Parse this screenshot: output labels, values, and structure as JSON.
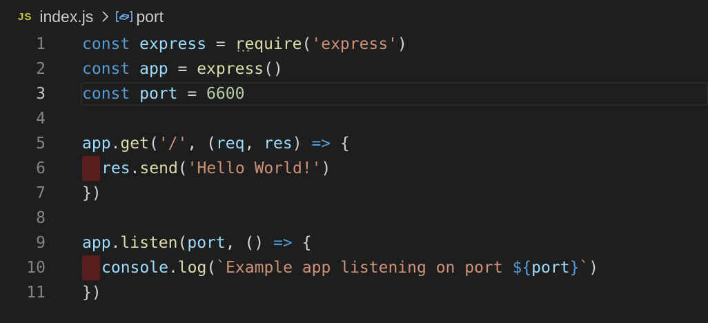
{
  "breadcrumb": {
    "file_icon": "JS",
    "file_name": "index.js",
    "separator_icon": "chevron-right-icon",
    "symbol_icon": "variable-icon",
    "symbol_name": "port"
  },
  "colors": {
    "background": "#1e1e1e",
    "keyword": "#569cd6",
    "variable": "#9cdcfe",
    "function": "#dcdcaa",
    "string": "#ce9178",
    "number": "#b5cea8",
    "indent_error": "#5a1d1d"
  },
  "editor": {
    "current_line": 3,
    "lines": [
      {
        "num": "1",
        "tokens": [
          [
            "kw",
            "const"
          ],
          [
            "op",
            " "
          ],
          [
            "var",
            "express"
          ],
          [
            "op",
            " = "
          ],
          [
            "fn",
            "require",
            "dotted"
          ],
          [
            "par",
            "("
          ],
          [
            "str",
            "'express'"
          ],
          [
            "par",
            ")"
          ]
        ]
      },
      {
        "num": "2",
        "tokens": [
          [
            "kw",
            "const"
          ],
          [
            "op",
            " "
          ],
          [
            "var",
            "app"
          ],
          [
            "op",
            " = "
          ],
          [
            "fn",
            "express"
          ],
          [
            "par",
            "()"
          ]
        ]
      },
      {
        "num": "3",
        "tokens": [
          [
            "kw",
            "const"
          ],
          [
            "op",
            " "
          ],
          [
            "var",
            "port"
          ],
          [
            "op",
            " = "
          ],
          [
            "num",
            "6600"
          ]
        ]
      },
      {
        "num": "4",
        "tokens": []
      },
      {
        "num": "5",
        "tokens": [
          [
            "var",
            "app"
          ],
          [
            "op",
            "."
          ],
          [
            "fn",
            "get"
          ],
          [
            "par",
            "("
          ],
          [
            "str",
            "'/'"
          ],
          [
            "op",
            ", "
          ],
          [
            "par",
            "("
          ],
          [
            "var",
            "req"
          ],
          [
            "op",
            ", "
          ],
          [
            "var",
            "res"
          ],
          [
            "par",
            ")"
          ],
          [
            "op",
            " "
          ],
          [
            "arrow",
            "=>"
          ],
          [
            "op",
            " "
          ],
          [
            "par",
            "{"
          ]
        ]
      },
      {
        "num": "6",
        "indent_error": true,
        "tokens": [
          [
            "var",
            "res"
          ],
          [
            "op",
            "."
          ],
          [
            "fn",
            "send"
          ],
          [
            "par",
            "("
          ],
          [
            "str",
            "'Hello World!'"
          ],
          [
            "par",
            ")"
          ]
        ]
      },
      {
        "num": "7",
        "tokens": [
          [
            "par",
            "})"
          ]
        ]
      },
      {
        "num": "8",
        "tokens": []
      },
      {
        "num": "9",
        "tokens": [
          [
            "var",
            "app"
          ],
          [
            "op",
            "."
          ],
          [
            "fn",
            "listen"
          ],
          [
            "par",
            "("
          ],
          [
            "var",
            "port"
          ],
          [
            "op",
            ", "
          ],
          [
            "par",
            "()"
          ],
          [
            "op",
            " "
          ],
          [
            "arrow",
            "=>"
          ],
          [
            "op",
            " "
          ],
          [
            "par",
            "{"
          ]
        ]
      },
      {
        "num": "10",
        "indent_error": true,
        "tokens": [
          [
            "var",
            "console"
          ],
          [
            "op",
            "."
          ],
          [
            "fn",
            "log"
          ],
          [
            "par",
            "("
          ],
          [
            "str",
            "`Example app listening on port "
          ],
          [
            "tplb",
            "${"
          ],
          [
            "var",
            "port"
          ],
          [
            "tplb",
            "}"
          ],
          [
            "str",
            "`"
          ],
          [
            "par",
            ")"
          ]
        ]
      },
      {
        "num": "11",
        "tokens": [
          [
            "par",
            "})"
          ]
        ]
      }
    ]
  }
}
